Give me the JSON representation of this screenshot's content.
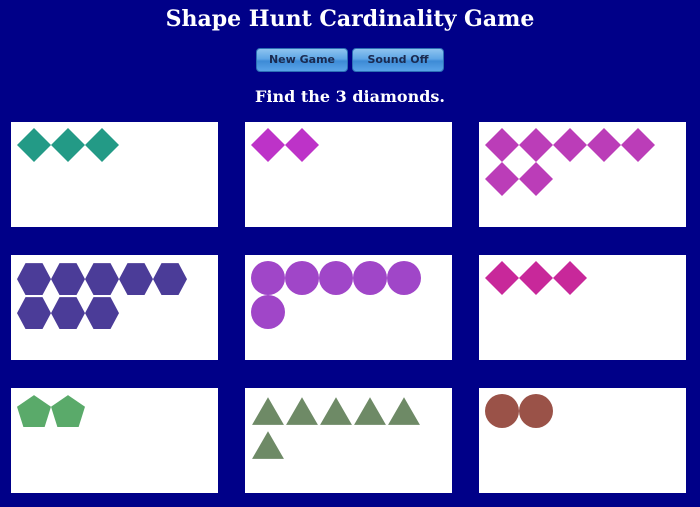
{
  "header": {
    "title": "Shape Hunt Cardinality Game"
  },
  "controls": {
    "new_game_label": "New Game",
    "sound_label": "Sound Off"
  },
  "prompt": {
    "text": "Find the 3 diamonds."
  },
  "cards": [
    {
      "shape": "diamond",
      "count": 3,
      "color": "#239a86"
    },
    {
      "shape": "diamond",
      "count": 2,
      "color": "#bd33c8"
    },
    {
      "shape": "diamond",
      "count": 7,
      "color": "#bb3db8"
    },
    {
      "shape": "hexagon",
      "count": 8,
      "color": "#4b3c98"
    },
    {
      "shape": "circle",
      "count": 6,
      "color": "#a046c8"
    },
    {
      "shape": "diamond",
      "count": 3,
      "color": "#c8289a"
    },
    {
      "shape": "pentagon",
      "count": 2,
      "color": "#5aaa6a"
    },
    {
      "shape": "triangle",
      "count": 6,
      "color": "#6e8a66"
    },
    {
      "shape": "circle",
      "count": 2,
      "color": "#9a5248"
    }
  ]
}
